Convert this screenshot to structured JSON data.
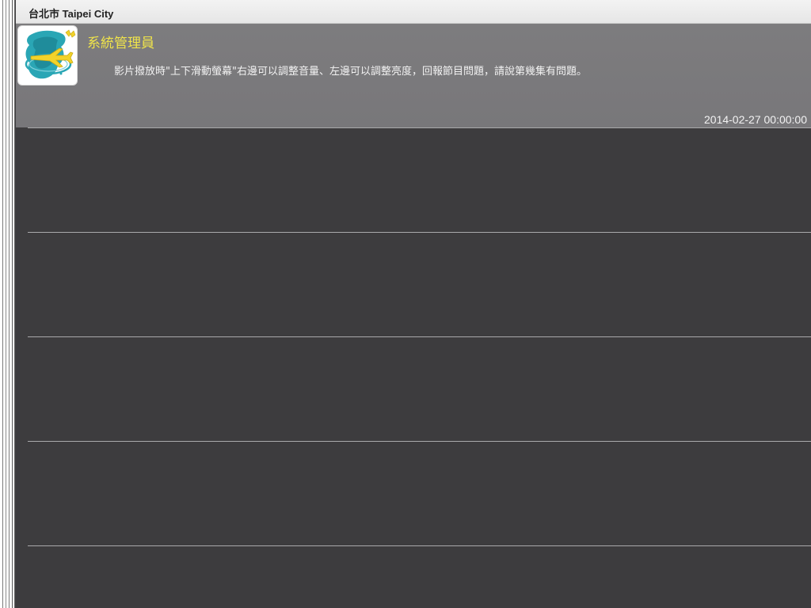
{
  "window": {
    "title": "台北市 Taipei City"
  },
  "post": {
    "author": "系統管理員",
    "avatar_icon": "formosa-airplane-logo-icon",
    "message": "影片撥放時\"上下滑動螢幕\"右邊可以調整音量、左邊可以調整亮度，回報節目問題，請說第幾集有問題。",
    "timestamp": "2014-02-27 00:00:00"
  },
  "colors": {
    "author_name": "#f0e44a",
    "header_background": "#7d7c7e",
    "list_background": "#3d3c3e",
    "divider": "#a9a9ab",
    "logo_teal": "#2aa6b5",
    "logo_yellow": "#f2d32a"
  }
}
